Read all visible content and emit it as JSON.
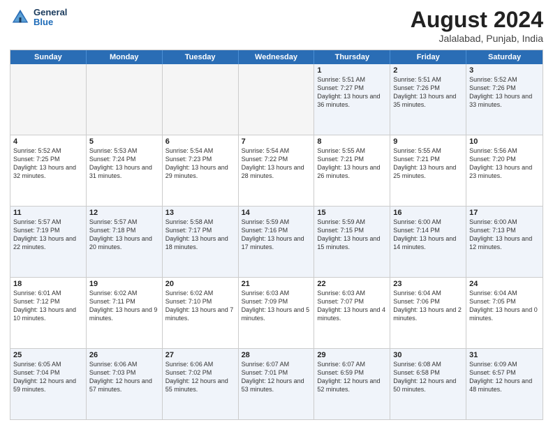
{
  "header": {
    "logo_line1": "General",
    "logo_line2": "Blue",
    "title": "August 2024",
    "location": "Jalalabad, Punjab, India"
  },
  "days_of_week": [
    "Sunday",
    "Monday",
    "Tuesday",
    "Wednesday",
    "Thursday",
    "Friday",
    "Saturday"
  ],
  "weeks": [
    [
      {
        "day": "",
        "info": "",
        "empty": true
      },
      {
        "day": "",
        "info": "",
        "empty": true
      },
      {
        "day": "",
        "info": "",
        "empty": true
      },
      {
        "day": "",
        "info": "",
        "empty": true
      },
      {
        "day": "1",
        "info": "Sunrise: 5:51 AM\nSunset: 7:27 PM\nDaylight: 13 hours\nand 36 minutes."
      },
      {
        "day": "2",
        "info": "Sunrise: 5:51 AM\nSunset: 7:26 PM\nDaylight: 13 hours\nand 35 minutes."
      },
      {
        "day": "3",
        "info": "Sunrise: 5:52 AM\nSunset: 7:26 PM\nDaylight: 13 hours\nand 33 minutes."
      }
    ],
    [
      {
        "day": "4",
        "info": "Sunrise: 5:52 AM\nSunset: 7:25 PM\nDaylight: 13 hours\nand 32 minutes."
      },
      {
        "day": "5",
        "info": "Sunrise: 5:53 AM\nSunset: 7:24 PM\nDaylight: 13 hours\nand 31 minutes."
      },
      {
        "day": "6",
        "info": "Sunrise: 5:54 AM\nSunset: 7:23 PM\nDaylight: 13 hours\nand 29 minutes."
      },
      {
        "day": "7",
        "info": "Sunrise: 5:54 AM\nSunset: 7:22 PM\nDaylight: 13 hours\nand 28 minutes."
      },
      {
        "day": "8",
        "info": "Sunrise: 5:55 AM\nSunset: 7:21 PM\nDaylight: 13 hours\nand 26 minutes."
      },
      {
        "day": "9",
        "info": "Sunrise: 5:55 AM\nSunset: 7:21 PM\nDaylight: 13 hours\nand 25 minutes."
      },
      {
        "day": "10",
        "info": "Sunrise: 5:56 AM\nSunset: 7:20 PM\nDaylight: 13 hours\nand 23 minutes."
      }
    ],
    [
      {
        "day": "11",
        "info": "Sunrise: 5:57 AM\nSunset: 7:19 PM\nDaylight: 13 hours\nand 22 minutes."
      },
      {
        "day": "12",
        "info": "Sunrise: 5:57 AM\nSunset: 7:18 PM\nDaylight: 13 hours\nand 20 minutes."
      },
      {
        "day": "13",
        "info": "Sunrise: 5:58 AM\nSunset: 7:17 PM\nDaylight: 13 hours\nand 18 minutes."
      },
      {
        "day": "14",
        "info": "Sunrise: 5:59 AM\nSunset: 7:16 PM\nDaylight: 13 hours\nand 17 minutes."
      },
      {
        "day": "15",
        "info": "Sunrise: 5:59 AM\nSunset: 7:15 PM\nDaylight: 13 hours\nand 15 minutes."
      },
      {
        "day": "16",
        "info": "Sunrise: 6:00 AM\nSunset: 7:14 PM\nDaylight: 13 hours\nand 14 minutes."
      },
      {
        "day": "17",
        "info": "Sunrise: 6:00 AM\nSunset: 7:13 PM\nDaylight: 13 hours\nand 12 minutes."
      }
    ],
    [
      {
        "day": "18",
        "info": "Sunrise: 6:01 AM\nSunset: 7:12 PM\nDaylight: 13 hours\nand 10 minutes."
      },
      {
        "day": "19",
        "info": "Sunrise: 6:02 AM\nSunset: 7:11 PM\nDaylight: 13 hours\nand 9 minutes."
      },
      {
        "day": "20",
        "info": "Sunrise: 6:02 AM\nSunset: 7:10 PM\nDaylight: 13 hours\nand 7 minutes."
      },
      {
        "day": "21",
        "info": "Sunrise: 6:03 AM\nSunset: 7:09 PM\nDaylight: 13 hours\nand 5 minutes."
      },
      {
        "day": "22",
        "info": "Sunrise: 6:03 AM\nSunset: 7:07 PM\nDaylight: 13 hours\nand 4 minutes."
      },
      {
        "day": "23",
        "info": "Sunrise: 6:04 AM\nSunset: 7:06 PM\nDaylight: 13 hours\nand 2 minutes."
      },
      {
        "day": "24",
        "info": "Sunrise: 6:04 AM\nSunset: 7:05 PM\nDaylight: 13 hours\nand 0 minutes."
      }
    ],
    [
      {
        "day": "25",
        "info": "Sunrise: 6:05 AM\nSunset: 7:04 PM\nDaylight: 12 hours\nand 59 minutes."
      },
      {
        "day": "26",
        "info": "Sunrise: 6:06 AM\nSunset: 7:03 PM\nDaylight: 12 hours\nand 57 minutes."
      },
      {
        "day": "27",
        "info": "Sunrise: 6:06 AM\nSunset: 7:02 PM\nDaylight: 12 hours\nand 55 minutes."
      },
      {
        "day": "28",
        "info": "Sunrise: 6:07 AM\nSunset: 7:01 PM\nDaylight: 12 hours\nand 53 minutes."
      },
      {
        "day": "29",
        "info": "Sunrise: 6:07 AM\nSunset: 6:59 PM\nDaylight: 12 hours\nand 52 minutes."
      },
      {
        "day": "30",
        "info": "Sunrise: 6:08 AM\nSunset: 6:58 PM\nDaylight: 12 hours\nand 50 minutes."
      },
      {
        "day": "31",
        "info": "Sunrise: 6:09 AM\nSunset: 6:57 PM\nDaylight: 12 hours\nand 48 minutes."
      }
    ]
  ]
}
